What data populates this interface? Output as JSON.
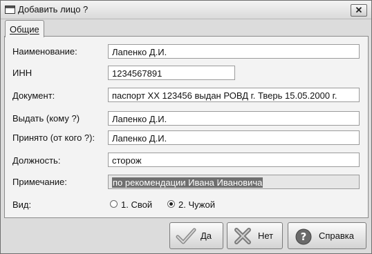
{
  "window": {
    "title": "Добавить лицо ?",
    "close_label": "✕"
  },
  "tabs": [
    {
      "label": "Общие"
    }
  ],
  "form": {
    "name_label": "Наименование:",
    "name_value": "Лапенко Д.И.",
    "inn_label": "ИНН",
    "inn_value": "1234567891",
    "document_label": "Документ:",
    "document_value": "паспорт XX 123456 выдан РОВД г. Тверь 15.05.2000 г.",
    "issue_to_label": "Выдать (кому ?)",
    "issue_to_value": "Лапенко Д.И.",
    "received_from_label": "Принято (от кого ?):",
    "received_from_value": "Лапенко Д.И.",
    "position_label": "Должность:",
    "position_value": "сторож",
    "note_label": "Примечание:",
    "note_value": "по рекомендации Ивана Ивановича",
    "type_label": "Вид:",
    "type_options": [
      {
        "label": "1. Свой",
        "selected": false
      },
      {
        "label": "2. Чужой",
        "selected": true
      }
    ]
  },
  "buttons": {
    "ok_label": "Да",
    "cancel_label": "Нет",
    "help_label": "Справка"
  }
}
